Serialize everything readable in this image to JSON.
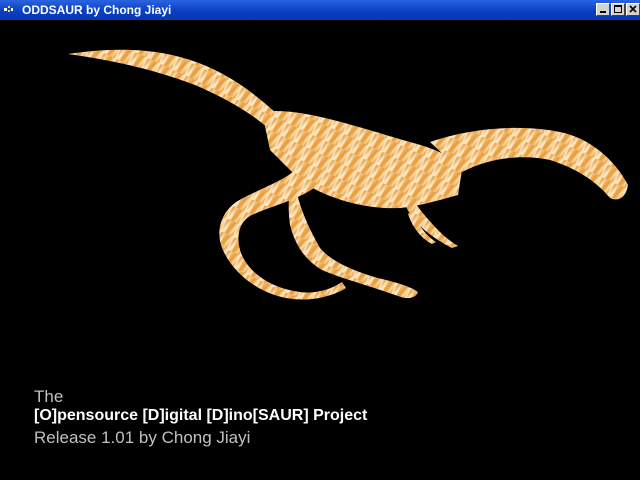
{
  "window": {
    "title": "ODDSAUR by Chong Jiayi",
    "controls": {
      "minimize": "minimize-icon",
      "maximize": "maximize-icon",
      "close": "close-icon"
    },
    "titlebar_color": "#0a3fc4"
  },
  "scene": {
    "background_color": "#000000",
    "model_colors": [
      "#f3c37a",
      "#e79a3c",
      "#fff0d2"
    ]
  },
  "caption": {
    "line1": "The",
    "line2": "[O]pensource [D]igital [D]ino[SAUR] Project",
    "line3": "Release 1.01 by Chong Jiayi"
  }
}
